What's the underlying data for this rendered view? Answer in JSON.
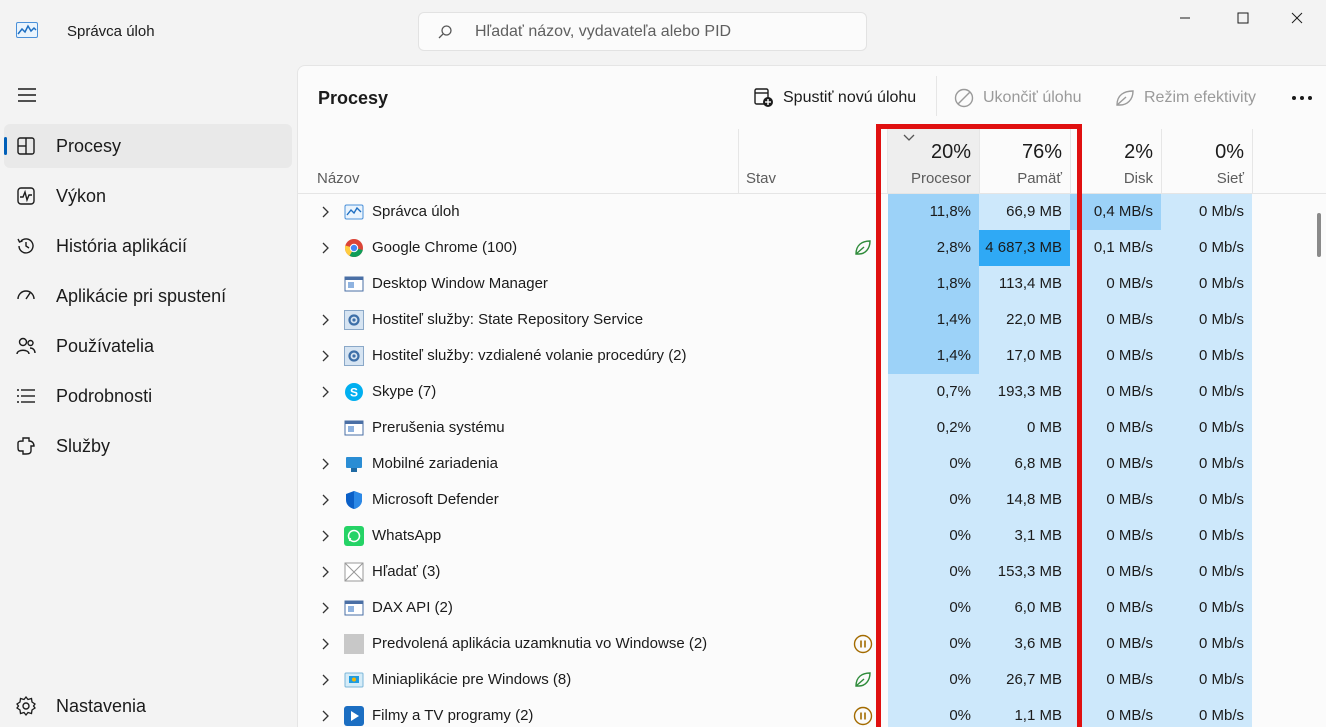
{
  "app": {
    "title": "Správca úloh"
  },
  "search": {
    "placeholder": "Hľadať názov, vydavateľa alebo PID"
  },
  "sidebar": {
    "items": [
      {
        "label": "Procesy",
        "icon": "processes-icon",
        "active": true
      },
      {
        "label": "Výkon",
        "icon": "performance-icon"
      },
      {
        "label": "História aplikácií",
        "icon": "history-icon"
      },
      {
        "label": "Aplikácie pri spustení",
        "icon": "startup-icon"
      },
      {
        "label": "Používatelia",
        "icon": "users-icon"
      },
      {
        "label": "Podrobnosti",
        "icon": "details-icon"
      },
      {
        "label": "Služby",
        "icon": "services-icon"
      }
    ],
    "settings_label": "Nastavenia"
  },
  "main": {
    "title": "Procesy",
    "toolbar": {
      "run_new_task": "Spustiť novú úlohu",
      "end_task": "Ukončiť úlohu",
      "efficiency_mode": "Režim efektivity"
    }
  },
  "table": {
    "columns": {
      "name": "Názov",
      "status": "Stav",
      "cpu": {
        "label": "Procesor",
        "total": "20%"
      },
      "memory": {
        "label": "Pamäť",
        "total": "76%"
      },
      "disk": {
        "label": "Disk",
        "total": "2%"
      },
      "network": {
        "label": "Sieť",
        "total": "0%"
      }
    },
    "rows": [
      {
        "name": "Správca úloh",
        "expand": true,
        "icon": "task-manager-icon",
        "status": "",
        "cpu": "11,8%",
        "memory": "66,9 MB",
        "disk": "0,4 MB/s",
        "network": "0 Mb/s",
        "cpu_level": 3,
        "mem_level": 1,
        "disk_level": 3
      },
      {
        "name": "Google Chrome (100)",
        "expand": true,
        "icon": "chrome-icon",
        "status": "efficiency",
        "cpu": "2,8%",
        "memory": "4 687,3 MB",
        "disk": "0,1 MB/s",
        "network": "0 Mb/s",
        "cpu_level": 3,
        "mem_level": 4,
        "disk_level": 1
      },
      {
        "name": "Desktop Window Manager",
        "expand": false,
        "icon": "window-icon",
        "status": "",
        "cpu": "1,8%",
        "memory": "113,4 MB",
        "disk": "0 MB/s",
        "network": "0 Mb/s",
        "cpu_level": 3,
        "mem_level": 1,
        "disk_level": 1
      },
      {
        "name": "Hostiteľ služby: State Repository Service",
        "expand": true,
        "icon": "gear-icon",
        "status": "",
        "cpu": "1,4%",
        "memory": "22,0 MB",
        "disk": "0 MB/s",
        "network": "0 Mb/s",
        "cpu_level": 3,
        "mem_level": 1,
        "disk_level": 1
      },
      {
        "name": "Hostiteľ služby: vzdialené volanie procedúry (2)",
        "expand": true,
        "icon": "gear-icon",
        "status": "",
        "cpu": "1,4%",
        "memory": "17,0 MB",
        "disk": "0 MB/s",
        "network": "0 Mb/s",
        "cpu_level": 3,
        "mem_level": 1,
        "disk_level": 1
      },
      {
        "name": "Skype (7)",
        "expand": true,
        "icon": "skype-icon",
        "status": "",
        "cpu": "0,7%",
        "memory": "193,3 MB",
        "disk": "0 MB/s",
        "network": "0 Mb/s",
        "cpu_level": 1,
        "mem_level": 1,
        "disk_level": 1
      },
      {
        "name": "Prerušenia systému",
        "expand": false,
        "icon": "window-icon",
        "status": "",
        "cpu": "0,2%",
        "memory": "0 MB",
        "disk": "0 MB/s",
        "network": "0 Mb/s",
        "cpu_level": 1,
        "mem_level": 1,
        "disk_level": 1
      },
      {
        "name": "Mobilné zariadenia",
        "expand": true,
        "icon": "mobile-devices-icon",
        "status": "",
        "cpu": "0%",
        "memory": "6,8 MB",
        "disk": "0 MB/s",
        "network": "0 Mb/s",
        "cpu_level": 1,
        "mem_level": 1,
        "disk_level": 1
      },
      {
        "name": "Microsoft Defender",
        "expand": true,
        "icon": "defender-shield-icon",
        "status": "",
        "cpu": "0%",
        "memory": "14,8 MB",
        "disk": "0 MB/s",
        "network": "0 Mb/s",
        "cpu_level": 1,
        "mem_level": 1,
        "disk_level": 1
      },
      {
        "name": "WhatsApp",
        "expand": true,
        "icon": "whatsapp-icon",
        "status": "",
        "cpu": "0%",
        "memory": "3,1 MB",
        "disk": "0 MB/s",
        "network": "0 Mb/s",
        "cpu_level": 1,
        "mem_level": 1,
        "disk_level": 1
      },
      {
        "name": "Hľadať (3)",
        "expand": true,
        "icon": "search-app-icon",
        "status": "",
        "cpu": "0%",
        "memory": "153,3 MB",
        "disk": "0 MB/s",
        "network": "0 Mb/s",
        "cpu_level": 1,
        "mem_level": 1,
        "disk_level": 1
      },
      {
        "name": "DAX API (2)",
        "expand": true,
        "icon": "window-icon",
        "status": "",
        "cpu": "0%",
        "memory": "6,0 MB",
        "disk": "0 MB/s",
        "network": "0 Mb/s",
        "cpu_level": 1,
        "mem_level": 1,
        "disk_level": 1
      },
      {
        "name": "Predvolená aplikácia uzamknutia vo Windowse (2)",
        "expand": true,
        "icon": "lockapp-icon",
        "status": "suspended",
        "cpu": "0%",
        "memory": "3,6 MB",
        "disk": "0 MB/s",
        "network": "0 Mb/s",
        "cpu_level": 1,
        "mem_level": 1,
        "disk_level": 1
      },
      {
        "name": "Miniaplikácie pre Windows (8)",
        "expand": true,
        "icon": "widgets-icon",
        "status": "efficiency",
        "cpu": "0%",
        "memory": "26,7 MB",
        "disk": "0 MB/s",
        "network": "0 Mb/s",
        "cpu_level": 1,
        "mem_level": 1,
        "disk_level": 1
      },
      {
        "name": "Filmy a TV programy (2)",
        "expand": true,
        "icon": "films-tv-icon",
        "status": "suspended",
        "cpu": "0%",
        "memory": "1,1 MB",
        "disk": "0 MB/s",
        "network": "0 Mb/s",
        "cpu_level": 1,
        "mem_level": 1,
        "disk_level": 1
      }
    ]
  },
  "colors": {
    "heat_low": "#cde8fb",
    "heat_med": "#9cd2f8",
    "heat_high": "#2fa9f5",
    "accent": "#005fb8",
    "highlight_border": "#e01010"
  }
}
